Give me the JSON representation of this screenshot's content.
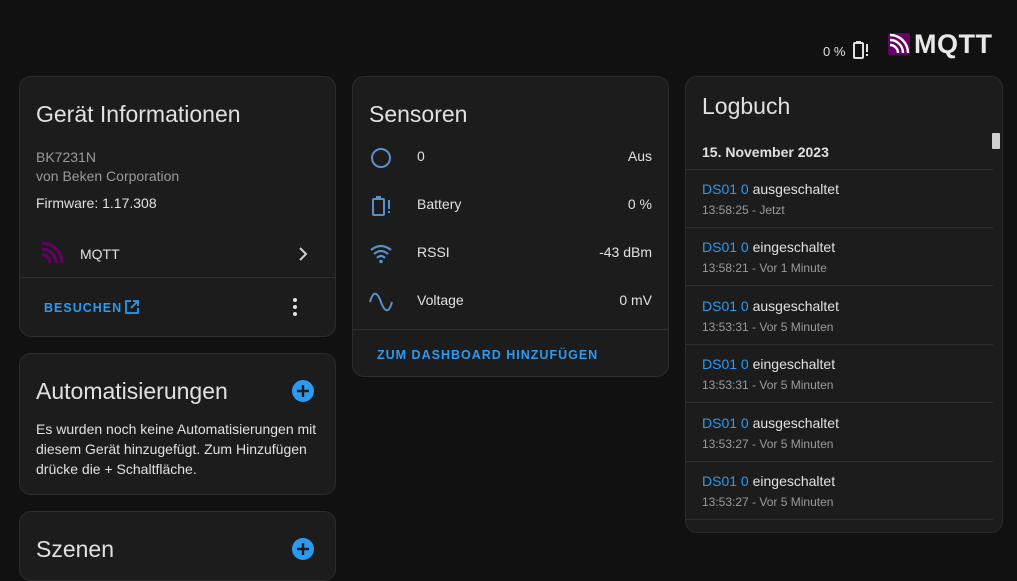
{
  "header": {
    "battery_text": "0 %",
    "brand": "MQTT"
  },
  "device_card": {
    "title": "Gerät Informationen",
    "model": "BK7231N",
    "manufacturer": "von Beken Corporation",
    "firmware": "Firmware: 1.17.308",
    "integration_label": "MQTT",
    "visit_label": "BESUCHEN"
  },
  "automations_card": {
    "title": "Automatisierungen",
    "text": "Es wurden noch keine Automatisierungen mit diesem Gerät hinzugefügt. Zum Hinzufügen drücke die + Schaltfläche."
  },
  "scenes_card": {
    "title": "Szenen"
  },
  "sensors_card": {
    "title": "Sensoren",
    "rows": [
      {
        "label": "0",
        "value": "Aus",
        "icon": "circle-outline-icon"
      },
      {
        "label": "Battery",
        "value": "0 %",
        "icon": "battery-alert-icon"
      },
      {
        "label": "RSSI",
        "value": "-43 dBm",
        "icon": "wifi-icon"
      },
      {
        "label": "Voltage",
        "value": "0 mV",
        "icon": "sine-wave-icon"
      }
    ],
    "add_dashboard_label": "ZUM DASHBOARD HINZUFÜGEN"
  },
  "logbook_card": {
    "title": "Logbuch",
    "date": "15. November 2023",
    "entries": [
      {
        "entity": "DS01 0",
        "action": "ausgeschaltet",
        "time": "13:58:25 - Jetzt"
      },
      {
        "entity": "DS01 0",
        "action": "eingeschaltet",
        "time": "13:58:21 - Vor 1 Minute"
      },
      {
        "entity": "DS01 0",
        "action": "ausgeschaltet",
        "time": "13:53:31 - Vor 5 Minuten"
      },
      {
        "entity": "DS01 0",
        "action": "eingeschaltet",
        "time": "13:53:31 - Vor 5 Minuten"
      },
      {
        "entity": "DS01 0",
        "action": "ausgeschaltet",
        "time": "13:53:27 - Vor 5 Minuten"
      },
      {
        "entity": "DS01 0",
        "action": "eingeschaltet",
        "time": "13:53:27 - Vor 5 Minuten"
      }
    ]
  },
  "colors": {
    "accent": "#2b9af3",
    "mqtt_purple": "#660066",
    "background": "#111111",
    "card": "#1c1c1c"
  }
}
